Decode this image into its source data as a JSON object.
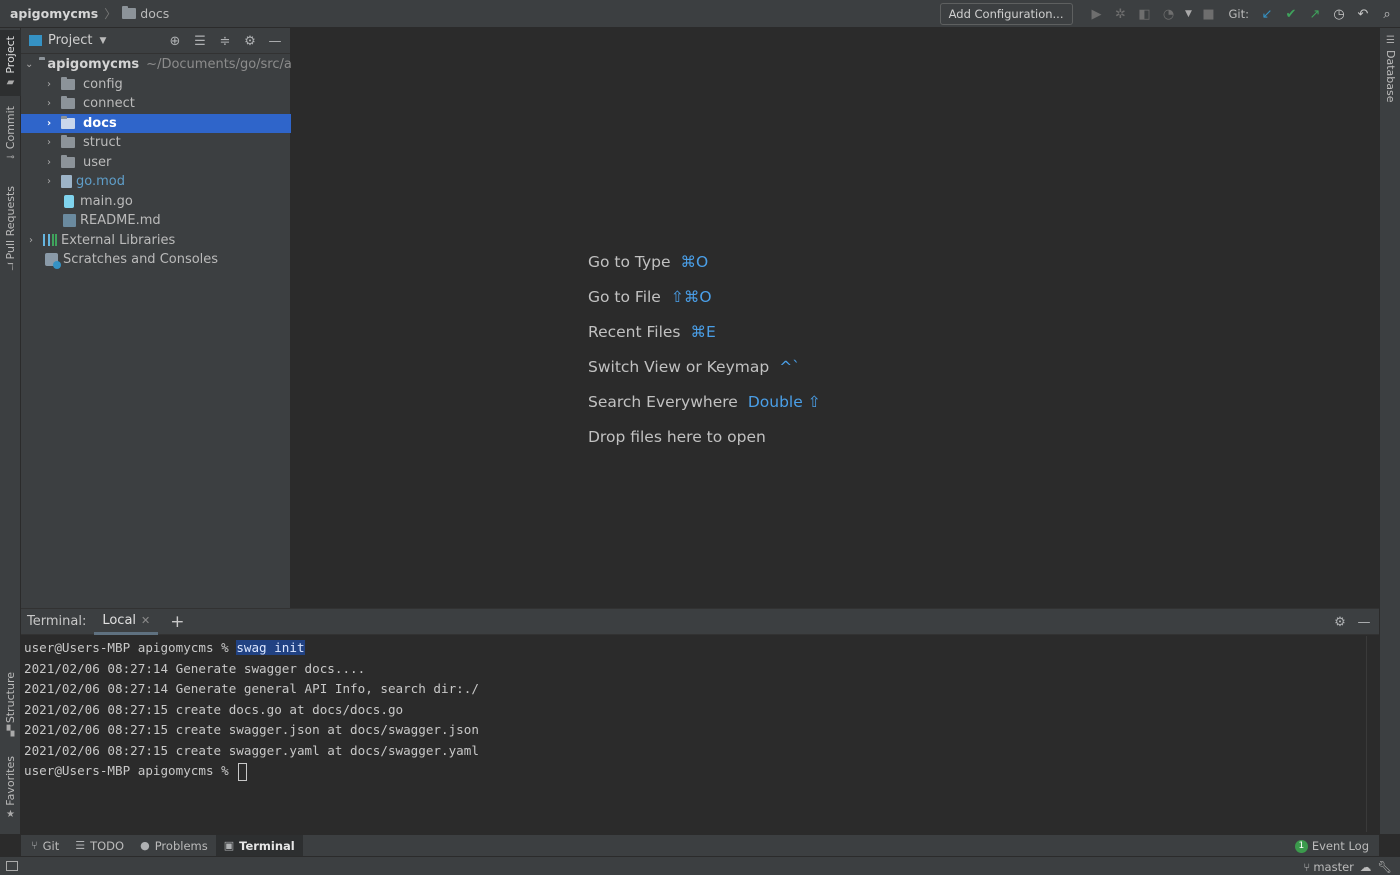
{
  "breadcrumb": {
    "project": "apigomycms",
    "folder": "docs"
  },
  "toolbar": {
    "add_config": "Add Configuration...",
    "git_label": "Git:"
  },
  "left_strip": {
    "project": "Project",
    "commit": "Commit",
    "pull_requests": "Pull Requests",
    "structure": "Structure",
    "favorites": "Favorites"
  },
  "right_strip": {
    "database": "Database"
  },
  "project_panel": {
    "title": "Project",
    "root": {
      "name": "apigomycms",
      "path": "~/Documents/go/src/a"
    },
    "items": [
      {
        "label": "config"
      },
      {
        "label": "connect"
      },
      {
        "label": "docs"
      },
      {
        "label": "struct"
      },
      {
        "label": "user"
      },
      {
        "label": "go.mod"
      },
      {
        "label": "main.go"
      },
      {
        "label": "README.md"
      },
      {
        "label": "External Libraries"
      },
      {
        "label": "Scratches and Consoles"
      }
    ]
  },
  "welcome": {
    "lines": [
      {
        "text": "Go to Type",
        "shortcut": "⌘O"
      },
      {
        "text": "Go to File",
        "shortcut": "⇧⌘O"
      },
      {
        "text": "Recent Files",
        "shortcut": "⌘E"
      },
      {
        "text": "Switch View or Keymap",
        "shortcut": "^`"
      },
      {
        "text": "Search Everywhere",
        "shortcut": "Double ⇧"
      },
      {
        "text": "Drop files here to open",
        "shortcut": ""
      }
    ]
  },
  "terminal": {
    "title": "Terminal:",
    "tab": "Local",
    "prompt": "user@Users-MBP apigomycms % ",
    "command": "swag init",
    "output": [
      "2021/02/06 08:27:14 Generate swagger docs....",
      "2021/02/06 08:27:14 Generate general API Info, search dir:./",
      "2021/02/06 08:27:15 create docs.go at docs/docs.go",
      "2021/02/06 08:27:15 create swagger.json at docs/swagger.json",
      "2021/02/06 08:27:15 create swagger.yaml at docs/swagger.yaml"
    ],
    "final_prompt": "user@Users-MBP apigomycms % "
  },
  "bottom_tabs": {
    "git": "Git",
    "todo": "TODO",
    "problems": "Problems",
    "terminal": "Terminal",
    "event_log": "Event Log",
    "event_count": "1"
  },
  "status": {
    "branch": "master"
  },
  "colors": {
    "selection": "#2f65ca",
    "shortcut": "#4a9fe8",
    "background": "#2b2b2b",
    "panel": "#3c3f41"
  }
}
